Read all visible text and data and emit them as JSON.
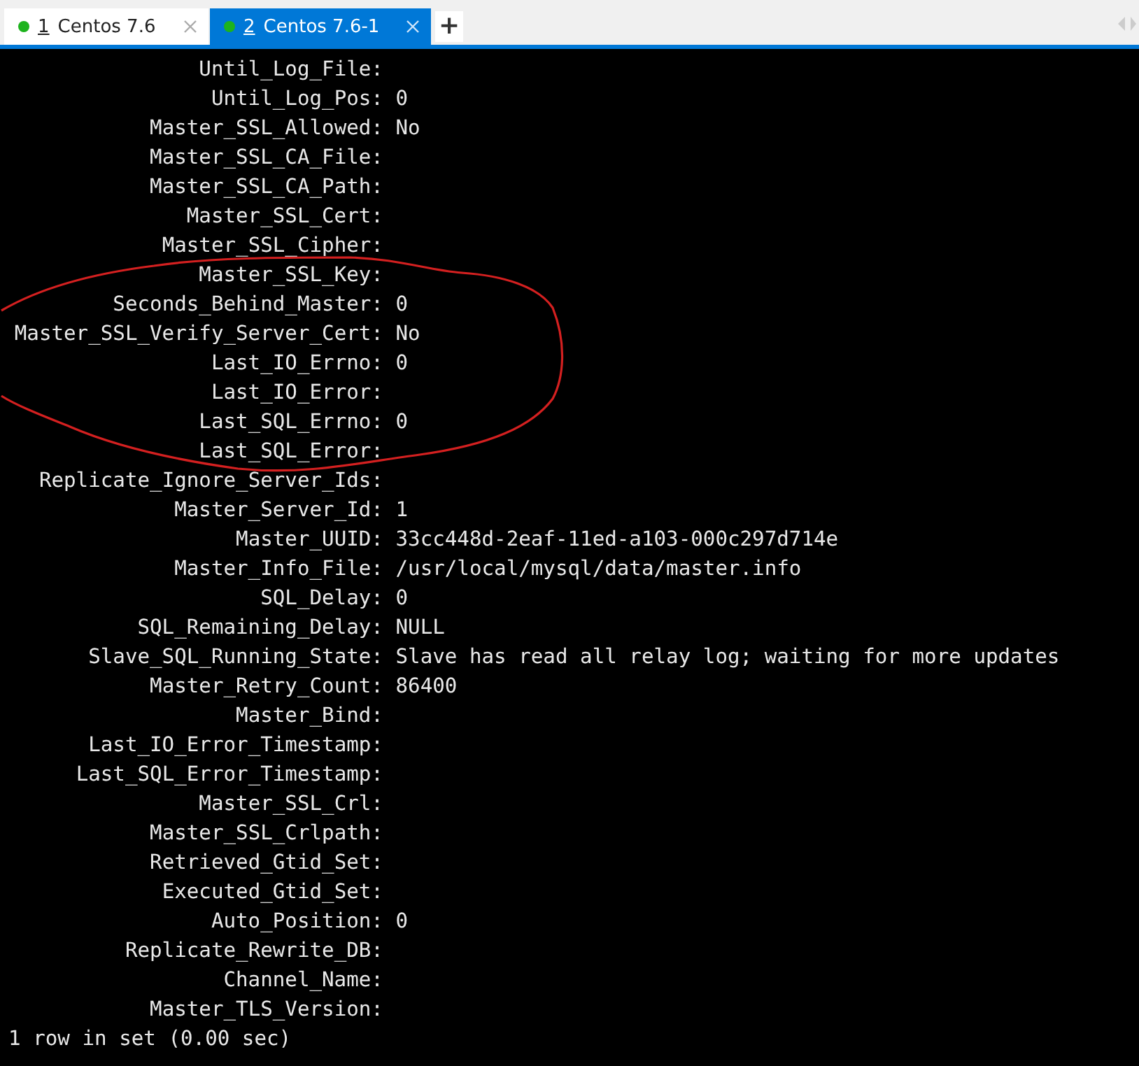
{
  "tabs": [
    {
      "number": "1",
      "title": "Centos 7.6",
      "color": "#1db31d",
      "selected": false
    },
    {
      "number": "2",
      "title": "Centos 7.6-1",
      "color": "#1db31d",
      "selected": true
    }
  ],
  "new_tab_button": "+",
  "terminal": {
    "rows": [
      {
        "field": "Until_Log_File:"
      },
      {
        "field": "Until_Log_Pos:",
        "value": "0"
      },
      {
        "field": "Master_SSL_Allowed:",
        "value": "No"
      },
      {
        "field": "Master_SSL_CA_File:"
      },
      {
        "field": "Master_SSL_CA_Path:"
      },
      {
        "field": "Master_SSL_Cert:"
      },
      {
        "field": "Master_SSL_Cipher:"
      },
      {
        "field": "Master_SSL_Key:"
      },
      {
        "field": "Seconds_Behind_Master:",
        "value": "0"
      },
      {
        "field": "Master_SSL_Verify_Server_Cert:",
        "value": "No"
      },
      {
        "field": "Last_IO_Errno:",
        "value": "0"
      },
      {
        "field": "Last_IO_Error:"
      },
      {
        "field": "Last_SQL_Errno:",
        "value": "0"
      },
      {
        "field": "Last_SQL_Error:"
      },
      {
        "field": "Replicate_Ignore_Server_Ids:"
      },
      {
        "field": "Master_Server_Id:",
        "value": "1"
      },
      {
        "field": "Master_UUID:",
        "value": "33cc448d-2eaf-11ed-a103-000c297d714e"
      },
      {
        "field": "Master_Info_File:",
        "value": "/usr/local/mysql/data/master.info"
      },
      {
        "field": "SQL_Delay:",
        "value": "0"
      },
      {
        "field": "SQL_Remaining_Delay:",
        "value": "NULL"
      },
      {
        "field": "Slave_SQL_Running_State:",
        "value": "Slave has read all relay log; waiting for more updates"
      },
      {
        "field": "Master_Retry_Count:",
        "value": "86400"
      },
      {
        "field": "Master_Bind:"
      },
      {
        "field": "Last_IO_Error_Timestamp:"
      },
      {
        "field": "Last_SQL_Error_Timestamp:"
      },
      {
        "field": "Master_SSL_Crl:"
      },
      {
        "field": "Master_SSL_Crlpath:"
      },
      {
        "field": "Retrieved_Gtid_Set:"
      },
      {
        "field": "Executed_Gtid_Set:"
      },
      {
        "field": "Auto_Position:",
        "value": "0"
      },
      {
        "field": "Replicate_Rewrite_DB:"
      },
      {
        "field": "Channel_Name:"
      },
      {
        "field": "Master_TLS_Version:"
      }
    ],
    "footer": "1 row in set (0.00 sec)"
  }
}
